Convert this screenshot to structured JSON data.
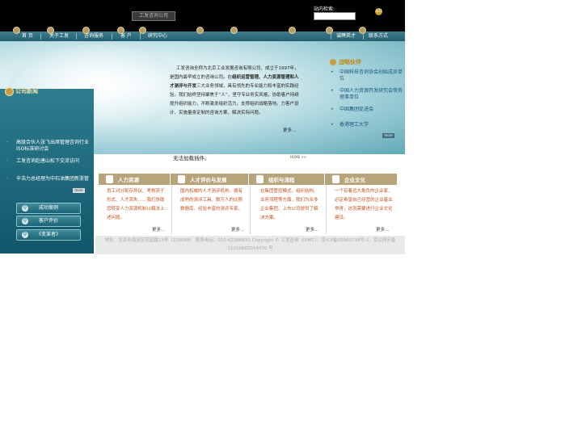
{
  "header": {
    "logo_text": "工发咨询公司",
    "search_label": "站内检索:",
    "search_value": "",
    "search_go": "GO"
  },
  "nav": {
    "items": [
      "首 页",
      "关于工发",
      "咨询服务",
      "客 户",
      "研究中心",
      "诚聘英才",
      "联系方式"
    ]
  },
  "sidebar": {
    "section_title": "公司新闻",
    "news": [
      "高级合伙人张飞出席管理咨询行业ISO标准研讨会",
      "工发咨询赴唐山松下交流访问",
      "辛浩力总经理为中石油集团新浙管"
    ],
    "more_label": "more",
    "buttons": [
      "成功案例",
      "客户评价",
      "《变革者》"
    ]
  },
  "intro": {
    "lead": "工发咨询全称为北京工业发展咨询有限公司，成立于1997年，是国内最早成立的咨询公司。在",
    "bold1": "组织运营管理、人力资源管理和人才测评与开发",
    "rest": "三大业务领域，具有领先的专业能力和丰富的实践经验。我们始终坚持聚焦于“人”，坚守专业务实风格，协助客户持续提升组织能力，不断激发组织活力，支撑组织战略落地。力客户设计、实施量身定制的咨询方案，解决实际问题。",
    "more": "更多..."
  },
  "partners": {
    "title": "战略伙伴",
    "items": [
      "中国科技咨询协会创始成员单位",
      "中国人力资源开发研究会常务理事单位",
      "中国集团促进会",
      "香港理工大学"
    ],
    "more_label": "more"
  },
  "plugin_notice": "无法加载插件。",
  "home_link": "HOME >>",
  "services": [
    {
      "title": "人力资源",
      "body": "员工对分配存异议、考核流于形式、人才流失……我们协助您转变人力资源机制以解决上述问题。",
      "more": "更多..."
    },
    {
      "title": "人才评价与发展",
      "body": "国内权威的人才测评机构，拥有成熟的测评工具、数万人的比照数据库、经验丰富的测评专家。",
      "more": "更多..."
    },
    {
      "title": "组织与流程",
      "body": "在集团管控模式、组织结构、业务流程等方面，我们为众多企业集团、上市公司提供了解决方案。",
      "more": "更多..."
    },
    {
      "title": "企业文化",
      "body": "一个有着远大抱负的企业家，必定希望自己经营的企业基业常青，这就需要进行企业文化建设。",
      "more": "更多..."
    }
  ],
  "footer": {
    "line1": "地址：北京市海淀区花园路13号（100088） 联系电话：010-62388831 Copyright © 工发咨询（IDMC），京ICP备05000716号-2，京公网安备",
    "line2": "11010802014070 号"
  },
  "colors": {
    "nav_bg": "#2f6f80",
    "sidebar_bg": "#1d6476",
    "service_header": "#b7a47a",
    "service_text": "#c5531f",
    "partner_text": "#15577e",
    "accent_gold": "#c28a1a"
  }
}
